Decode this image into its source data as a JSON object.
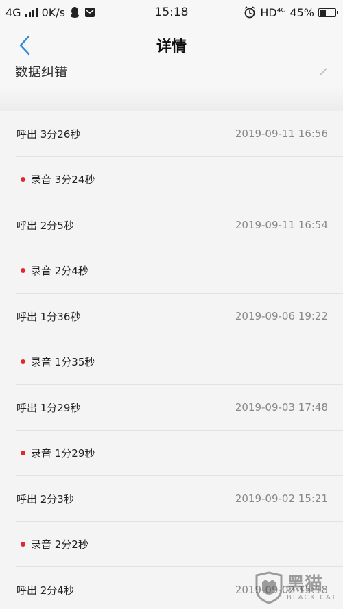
{
  "status_bar": {
    "network": "4G",
    "speed": "0K/s",
    "time": "15:18",
    "hd": "HD",
    "net_small": "4G",
    "battery": "45%",
    "battery_level": 0.45
  },
  "header": {
    "title": "详情"
  },
  "cutoff_text": "数据纠错",
  "calls": [
    {
      "label": "呼出 3分26秒",
      "time": "2019-09-11 16:56",
      "recording": "录音 3分24秒"
    },
    {
      "label": "呼出 2分5秒",
      "time": "2019-09-11 16:54",
      "recording": "录音 2分4秒"
    },
    {
      "label": "呼出 1分36秒",
      "time": "2019-09-06 19:22",
      "recording": "录音 1分35秒"
    },
    {
      "label": "呼出 1分29秒",
      "time": "2019-09-03 17:48",
      "recording": "录音 1分29秒"
    },
    {
      "label": "呼出 2分3秒",
      "time": "2019-09-02 15:21",
      "recording": "录音 2分2秒"
    },
    {
      "label": "呼出 2分4秒",
      "time": "2019-09-02 15:18"
    }
  ],
  "watermark": {
    "cn": "黑猫",
    "en": "BLACK CAT"
  },
  "colors": {
    "accent": "#2f8bd6",
    "dot": "#e0282d"
  }
}
